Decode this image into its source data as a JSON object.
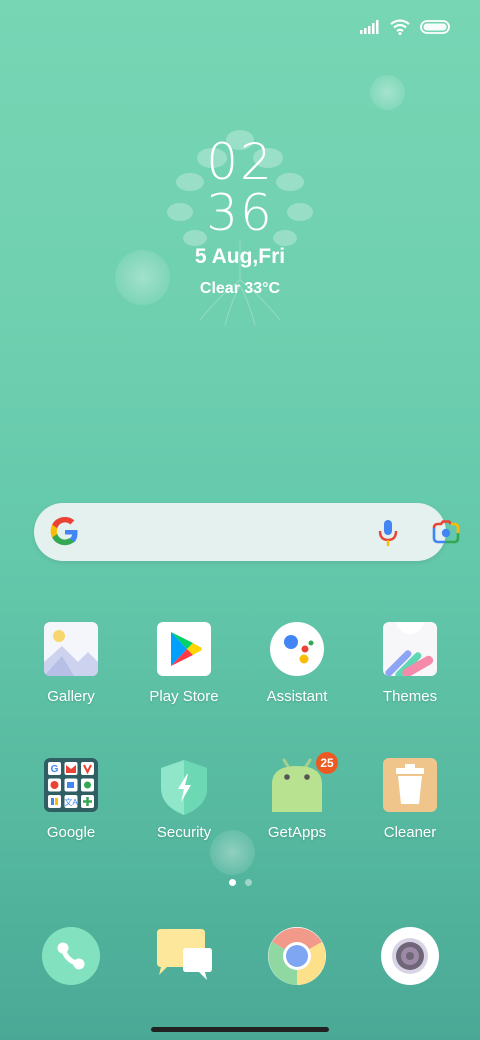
{
  "status_bar": {
    "icons": [
      "signal-icon",
      "wifi-icon",
      "battery-icon"
    ]
  },
  "clock": {
    "hour": "02",
    "minute": "36",
    "date": "5 Aug,Fri",
    "weather": "Clear 33°C"
  },
  "search": {
    "icons": [
      "google-g-icon",
      "microphone-icon",
      "google-lens-icon"
    ]
  },
  "apps": [
    {
      "label": "Gallery",
      "icon": "gallery-icon"
    },
    {
      "label": "Play Store",
      "icon": "play-store-icon"
    },
    {
      "label": "Assistant",
      "icon": "assistant-icon"
    },
    {
      "label": "Themes",
      "icon": "themes-icon"
    },
    {
      "label": "Google",
      "icon": "google-folder-icon"
    },
    {
      "label": "Security",
      "icon": "security-icon"
    },
    {
      "label": "GetApps",
      "icon": "getapps-icon",
      "badge": "25"
    },
    {
      "label": "Cleaner",
      "icon": "cleaner-icon"
    }
  ],
  "page_indicator": {
    "pages": 2,
    "current": 1
  },
  "dock": [
    {
      "name": "Phone",
      "icon": "phone-icon"
    },
    {
      "name": "Messages",
      "icon": "messages-icon"
    },
    {
      "name": "Chrome",
      "icon": "chrome-icon"
    },
    {
      "name": "Camera",
      "icon": "camera-icon"
    }
  ],
  "colors": {
    "wallpaper_top": "#77d6b4",
    "wallpaper_bottom": "#4aa996",
    "badge": "#ec5a22"
  }
}
